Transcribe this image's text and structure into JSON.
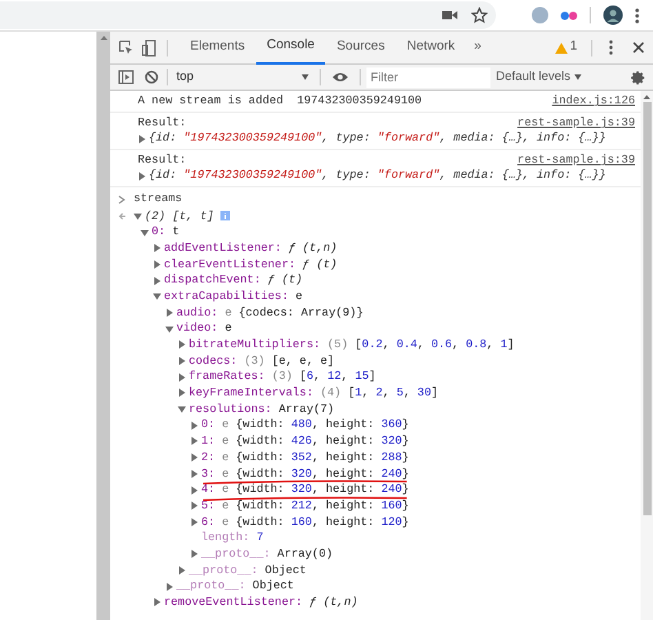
{
  "tabs": [
    {
      "label": "Elements",
      "selected": false
    },
    {
      "label": "Console",
      "selected": true
    },
    {
      "label": "Sources",
      "selected": false
    },
    {
      "label": "Network",
      "selected": false
    }
  ],
  "more_tabs": "»",
  "warnings": "1",
  "toolbar": {
    "context": "top",
    "filter": {
      "placeholder": "Filter"
    },
    "levels": "Default levels"
  },
  "messages": [
    {
      "kind": "log",
      "text": "A new stream is added  197432300359249100",
      "source": "index.js:126"
    },
    {
      "kind": "result",
      "text": "Result:",
      "source": "rest-sample.js:39",
      "preview": [
        {
          "kind": "italic",
          "text": "{id: "
        },
        {
          "kind": "string",
          "text": "\"197432300359249100\""
        },
        {
          "kind": "italic",
          "text": ", type: "
        },
        {
          "kind": "string",
          "text": "\"forward\""
        },
        {
          "kind": "italic",
          "text": ", media: {…}, info: {…}}"
        }
      ]
    },
    {
      "kind": "result",
      "text": "Result:",
      "source": "rest-sample.js:39",
      "preview": [
        {
          "kind": "italic",
          "text": "{id: "
        },
        {
          "kind": "string",
          "text": "\"197432300359249100\""
        },
        {
          "kind": "italic",
          "text": ", type: "
        },
        {
          "kind": "string",
          "text": "\"forward\""
        },
        {
          "kind": "italic",
          "text": ", media: {…}, info: {…}}"
        }
      ]
    }
  ],
  "input": "streams",
  "result": {
    "expanded": true,
    "value": [
      {
        "kind": "italic",
        "text": "(2) [t, t]"
      }
    ],
    "children": [
      {
        "key": "0:",
        "internal": false,
        "kind": "expandable",
        "expanded": true,
        "underlined": false,
        "value": [
          {
            "kind": "plain",
            "text": "t"
          }
        ],
        "children": [
          {
            "key": "addEventListener:",
            "internal": false,
            "kind": "expandable",
            "expanded": false,
            "underlined": false,
            "value": [
              {
                "kind": "func",
                "text": "ƒ (t,n)"
              }
            ]
          },
          {
            "key": "clearEventListener:",
            "internal": false,
            "kind": "expandable",
            "expanded": false,
            "underlined": false,
            "value": [
              {
                "kind": "func",
                "text": "ƒ (t)"
              }
            ]
          },
          {
            "key": "dispatchEvent:",
            "internal": false,
            "kind": "expandable",
            "expanded": false,
            "underlined": false,
            "value": [
              {
                "kind": "func",
                "text": "ƒ (t)"
              }
            ]
          },
          {
            "key": "extraCapabilities:",
            "internal": false,
            "kind": "expandable",
            "expanded": true,
            "underlined": false,
            "value": [
              {
                "kind": "plain",
                "text": "e"
              }
            ],
            "children": [
              {
                "key": "audio:",
                "internal": false,
                "kind": "expandable",
                "expanded": false,
                "underlined": false,
                "value": [
                  {
                    "kind": "dim",
                    "text": "e "
                  },
                  {
                    "kind": "plain",
                    "text": "{codecs: Array(9)}"
                  }
                ]
              },
              {
                "key": "video:",
                "internal": false,
                "kind": "expandable",
                "expanded": true,
                "underlined": false,
                "value": [
                  {
                    "kind": "plain",
                    "text": "e"
                  }
                ],
                "children": [
                  {
                    "key": "bitrateMultipliers:",
                    "internal": false,
                    "kind": "expandable",
                    "expanded": false,
                    "underlined": false,
                    "value": [
                      {
                        "kind": "dim",
                        "text": "(5) "
                      },
                      {
                        "kind": "plain",
                        "text": "["
                      },
                      {
                        "kind": "number",
                        "text": "0.2"
                      },
                      {
                        "kind": "plain",
                        "text": ", "
                      },
                      {
                        "kind": "number",
                        "text": "0.4"
                      },
                      {
                        "kind": "plain",
                        "text": ", "
                      },
                      {
                        "kind": "number",
                        "text": "0.6"
                      },
                      {
                        "kind": "plain",
                        "text": ", "
                      },
                      {
                        "kind": "number",
                        "text": "0.8"
                      },
                      {
                        "kind": "plain",
                        "text": ", "
                      },
                      {
                        "kind": "number",
                        "text": "1"
                      },
                      {
                        "kind": "plain",
                        "text": "]"
                      }
                    ]
                  },
                  {
                    "key": "codecs:",
                    "internal": false,
                    "kind": "expandable",
                    "expanded": false,
                    "underlined": false,
                    "value": [
                      {
                        "kind": "dim",
                        "text": "(3) "
                      },
                      {
                        "kind": "plain",
                        "text": "[e, e, e]"
                      }
                    ]
                  },
                  {
                    "key": "frameRates:",
                    "internal": false,
                    "kind": "expandable",
                    "expanded": false,
                    "underlined": false,
                    "value": [
                      {
                        "kind": "dim",
                        "text": "(3) "
                      },
                      {
                        "kind": "plain",
                        "text": "["
                      },
                      {
                        "kind": "number",
                        "text": "6"
                      },
                      {
                        "kind": "plain",
                        "text": ", "
                      },
                      {
                        "kind": "number",
                        "text": "12"
                      },
                      {
                        "kind": "plain",
                        "text": ", "
                      },
                      {
                        "kind": "number",
                        "text": "15"
                      },
                      {
                        "kind": "plain",
                        "text": "]"
                      }
                    ]
                  },
                  {
                    "key": "keyFrameIntervals:",
                    "internal": false,
                    "kind": "expandable",
                    "expanded": false,
                    "underlined": false,
                    "value": [
                      {
                        "kind": "dim",
                        "text": "(4) "
                      },
                      {
                        "kind": "plain",
                        "text": "["
                      },
                      {
                        "kind": "number",
                        "text": "1"
                      },
                      {
                        "kind": "plain",
                        "text": ", "
                      },
                      {
                        "kind": "number",
                        "text": "2"
                      },
                      {
                        "kind": "plain",
                        "text": ", "
                      },
                      {
                        "kind": "number",
                        "text": "5"
                      },
                      {
                        "kind": "plain",
                        "text": ", "
                      },
                      {
                        "kind": "number",
                        "text": "30"
                      },
                      {
                        "kind": "plain",
                        "text": "]"
                      }
                    ]
                  },
                  {
                    "key": "resolutions:",
                    "internal": false,
                    "kind": "expandable",
                    "expanded": true,
                    "underlined": false,
                    "value": [
                      {
                        "kind": "plain",
                        "text": "Array(7)"
                      }
                    ],
                    "children": [
                      {
                        "key": "0:",
                        "internal": false,
                        "kind": "expandable",
                        "expanded": false,
                        "underlined": false,
                        "value": [
                          {
                            "kind": "dim",
                            "text": "e "
                          },
                          {
                            "kind": "plain",
                            "text": "{width: "
                          },
                          {
                            "kind": "number",
                            "text": "480"
                          },
                          {
                            "kind": "plain",
                            "text": ", height: "
                          },
                          {
                            "kind": "number",
                            "text": "360"
                          },
                          {
                            "kind": "plain",
                            "text": "}"
                          }
                        ]
                      },
                      {
                        "key": "1:",
                        "internal": false,
                        "kind": "expandable",
                        "expanded": false,
                        "underlined": false,
                        "value": [
                          {
                            "kind": "dim",
                            "text": "e "
                          },
                          {
                            "kind": "plain",
                            "text": "{width: "
                          },
                          {
                            "kind": "number",
                            "text": "426"
                          },
                          {
                            "kind": "plain",
                            "text": ", height: "
                          },
                          {
                            "kind": "number",
                            "text": "320"
                          },
                          {
                            "kind": "plain",
                            "text": "}"
                          }
                        ]
                      },
                      {
                        "key": "2:",
                        "internal": false,
                        "kind": "expandable",
                        "expanded": false,
                        "underlined": false,
                        "value": [
                          {
                            "kind": "dim",
                            "text": "e "
                          },
                          {
                            "kind": "plain",
                            "text": "{width: "
                          },
                          {
                            "kind": "number",
                            "text": "352"
                          },
                          {
                            "kind": "plain",
                            "text": ", height: "
                          },
                          {
                            "kind": "number",
                            "text": "288"
                          },
                          {
                            "kind": "plain",
                            "text": "}"
                          }
                        ]
                      },
                      {
                        "key": "3:",
                        "internal": false,
                        "kind": "expandable",
                        "expanded": false,
                        "underlined": true,
                        "value": [
                          {
                            "kind": "dim",
                            "text": "e "
                          },
                          {
                            "kind": "plain",
                            "text": "{width: "
                          },
                          {
                            "kind": "number",
                            "text": "320"
                          },
                          {
                            "kind": "plain",
                            "text": ", height: "
                          },
                          {
                            "kind": "number",
                            "text": "240"
                          },
                          {
                            "kind": "plain",
                            "text": "}"
                          }
                        ]
                      },
                      {
                        "key": "4:",
                        "internal": false,
                        "kind": "expandable",
                        "expanded": false,
                        "underlined": true,
                        "value": [
                          {
                            "kind": "dim",
                            "text": "e "
                          },
                          {
                            "kind": "plain",
                            "text": "{width: "
                          },
                          {
                            "kind": "number",
                            "text": "320"
                          },
                          {
                            "kind": "plain",
                            "text": ", height: "
                          },
                          {
                            "kind": "number",
                            "text": "240"
                          },
                          {
                            "kind": "plain",
                            "text": "}"
                          }
                        ]
                      },
                      {
                        "key": "5:",
                        "internal": false,
                        "kind": "expandable",
                        "expanded": false,
                        "underlined": false,
                        "value": [
                          {
                            "kind": "dim",
                            "text": "e "
                          },
                          {
                            "kind": "plain",
                            "text": "{width: "
                          },
                          {
                            "kind": "number",
                            "text": "212"
                          },
                          {
                            "kind": "plain",
                            "text": ", height: "
                          },
                          {
                            "kind": "number",
                            "text": "160"
                          },
                          {
                            "kind": "plain",
                            "text": "}"
                          }
                        ]
                      },
                      {
                        "key": "6:",
                        "internal": false,
                        "kind": "expandable",
                        "expanded": false,
                        "underlined": false,
                        "value": [
                          {
                            "kind": "dim",
                            "text": "e "
                          },
                          {
                            "kind": "plain",
                            "text": "{width: "
                          },
                          {
                            "kind": "number",
                            "text": "160"
                          },
                          {
                            "kind": "plain",
                            "text": ", height: "
                          },
                          {
                            "kind": "number",
                            "text": "120"
                          },
                          {
                            "kind": "plain",
                            "text": "}"
                          }
                        ]
                      },
                      {
                        "key": "length:",
                        "internal": true,
                        "kind": "leaf",
                        "underlined": false,
                        "value": [
                          {
                            "kind": "number",
                            "text": "7"
                          }
                        ]
                      },
                      {
                        "key": "__proto__:",
                        "internal": true,
                        "kind": "expandable",
                        "expanded": false,
                        "underlined": false,
                        "value": [
                          {
                            "kind": "plain",
                            "text": "Array(0)"
                          }
                        ]
                      }
                    ]
                  },
                  {
                    "key": "__proto__:",
                    "internal": true,
                    "kind": "expandable",
                    "expanded": false,
                    "underlined": false,
                    "value": [
                      {
                        "kind": "plain",
                        "text": "Object"
                      }
                    ]
                  }
                ]
              },
              {
                "key": "__proto__:",
                "internal": true,
                "kind": "expandable",
                "expanded": false,
                "underlined": false,
                "value": [
                  {
                    "kind": "plain",
                    "text": "Object"
                  }
                ]
              }
            ]
          },
          {
            "key": "removeEventListener:",
            "internal": false,
            "kind": "expandable",
            "expanded": false,
            "underlined": false,
            "value": [
              {
                "kind": "func",
                "text": "ƒ (t,n)"
              }
            ]
          }
        ]
      }
    ]
  }
}
